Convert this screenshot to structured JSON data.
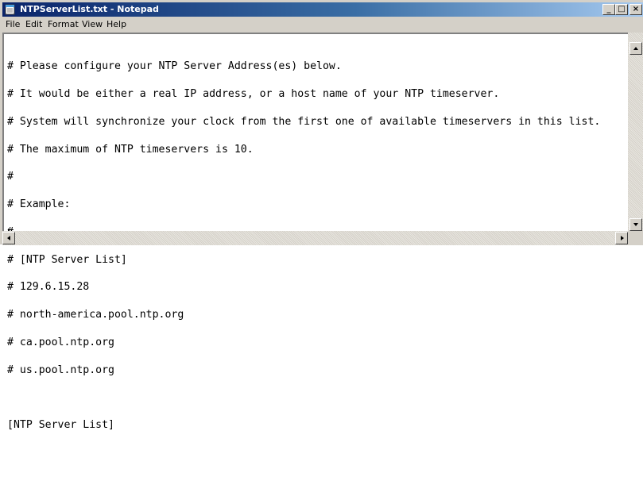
{
  "window": {
    "title": "NTPServerList.txt - Notepad",
    "min_label": "_",
    "max_label": "□",
    "close_label": "×"
  },
  "menu": {
    "items": [
      "File",
      "Edit",
      "Format",
      "View",
      "Help"
    ]
  },
  "document": {
    "lines": [
      "# Please configure your NTP Server Address(es) below.",
      "# It would be either a real IP address, or a host name of your NTP timeserver.",
      "# System will synchronize your clock from the first one of available timeservers in this list.",
      "# The maximum of NTP timeservers is 10.",
      "#",
      "# Example:",
      "#",
      "# [NTP Server List]",
      "# 129.6.15.28",
      "# north-america.pool.ntp.org",
      "# ca.pool.ntp.org",
      "# us.pool.ntp.org",
      "",
      "[NTP Server List]",
      ""
    ]
  },
  "colors": {
    "title_gradient_start": "#0a246a",
    "title_gradient_end": "#a6caf0",
    "chrome": "#d4d0c8"
  }
}
